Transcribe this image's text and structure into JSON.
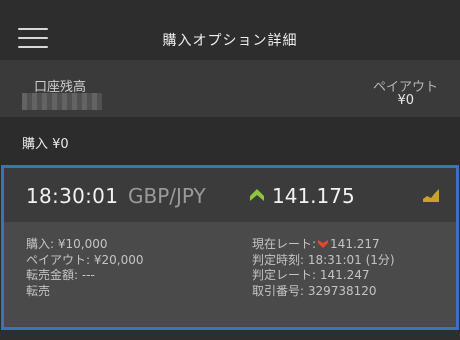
{
  "header": {
    "title": "購入オプション詳細"
  },
  "summary": {
    "balance_label": "口座残高",
    "payout_label": "ペイアウト",
    "payout_value": "¥0"
  },
  "purchase": {
    "text": "購入 ¥0"
  },
  "option": {
    "time": "18:30:01",
    "pair": "GBP/JPY",
    "price": "141.175",
    "direction_icon": "arrow-up-icon",
    "left": {
      "purchase": "購入: ¥10,000",
      "payout": "ペイアウト: ¥20,000",
      "resale_amount": "転売金額: ---",
      "resale": "転売"
    },
    "right": {
      "current_rate_label": "現在レート:",
      "current_rate_value": "141.217",
      "judgement_time": "判定時刻: 18:31:01 (1分)",
      "judgement_rate": "判定レート: 141.247",
      "trade_number": "取引番号: 329738120"
    }
  },
  "colors": {
    "accent_border": "#3a73b9",
    "up_green": "#8cc63f",
    "down_red": "#e8452f",
    "chart_gold": "#c9a227"
  }
}
